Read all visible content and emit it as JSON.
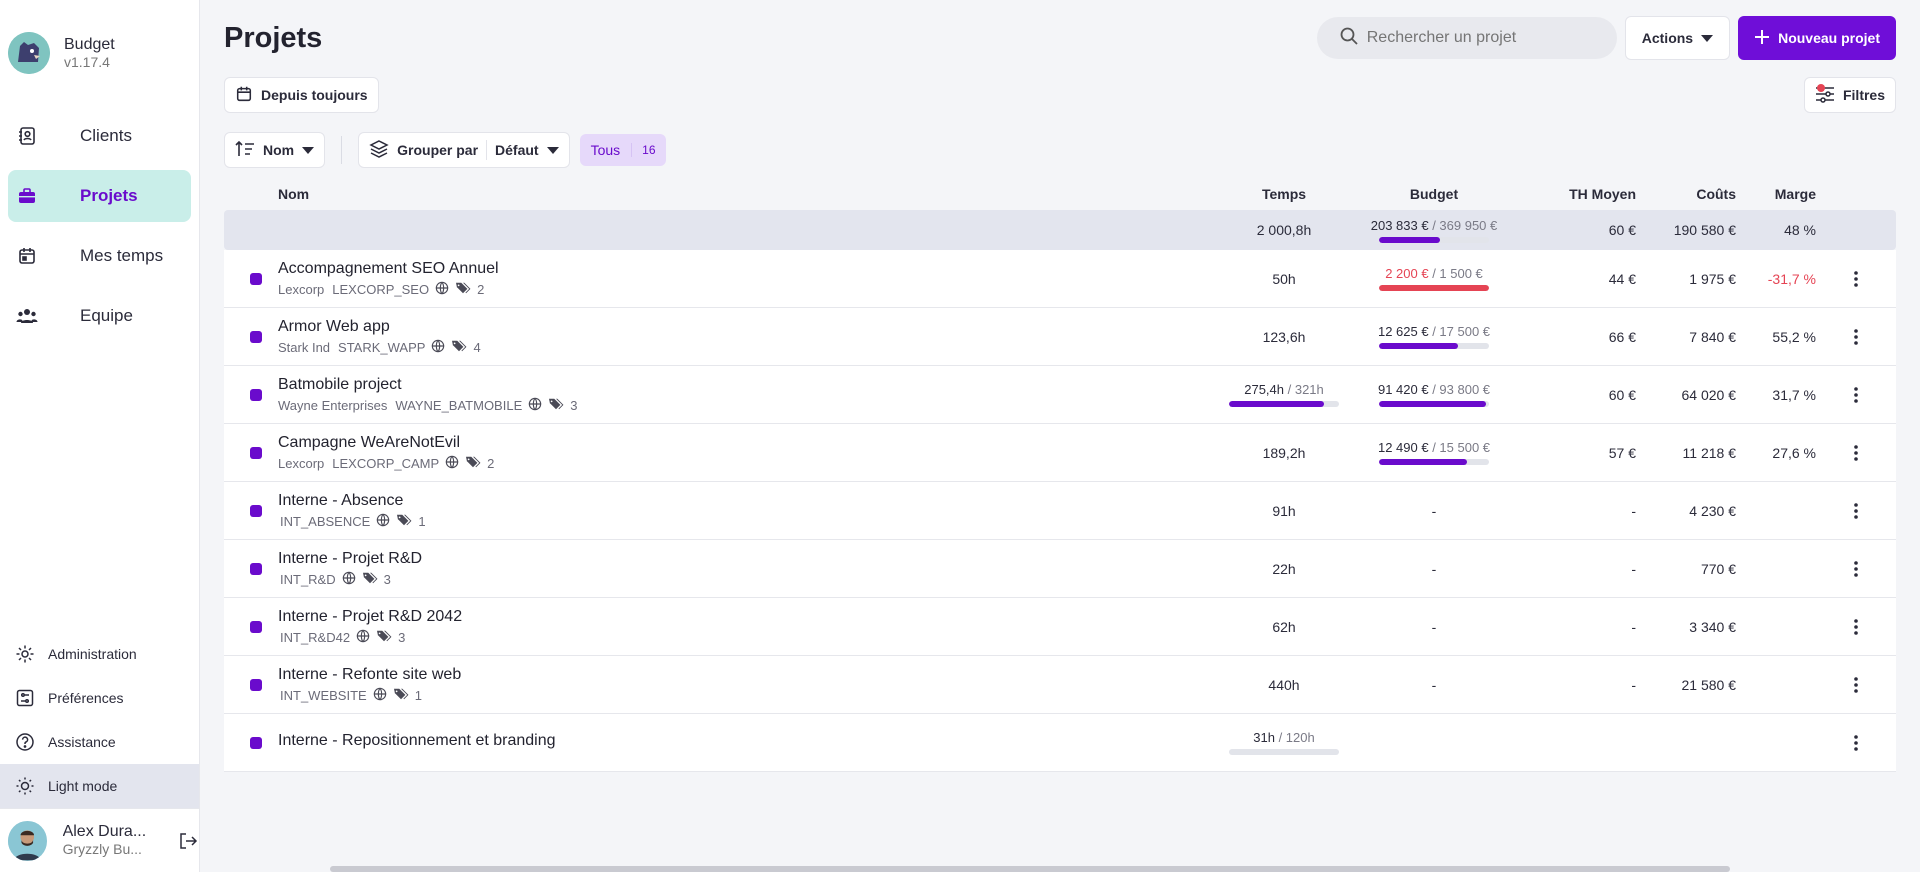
{
  "app": {
    "name": "Budget",
    "version": "v1.17.4"
  },
  "nav": [
    {
      "label": "Clients",
      "icon": "contacts-icon"
    },
    {
      "label": "Projets",
      "icon": "briefcase-icon"
    },
    {
      "label": "Mes temps",
      "icon": "calendar-icon"
    },
    {
      "label": "Equipe",
      "icon": "team-icon"
    }
  ],
  "bottom_nav": [
    {
      "label": "Administration",
      "icon": "gear-icon"
    },
    {
      "label": "Préférences",
      "icon": "sliders-icon"
    },
    {
      "label": "Assistance",
      "icon": "help-icon"
    },
    {
      "label": "Light mode",
      "icon": "sun-icon"
    }
  ],
  "user": {
    "name": "Alex Dura...",
    "org": "Gryzzly Bu..."
  },
  "header": {
    "title": "Projets",
    "search_placeholder": "Rechercher un projet",
    "actions_label": "Actions",
    "new_label": "Nouveau projet"
  },
  "period": {
    "label": "Depuis toujours"
  },
  "filters": {
    "label": "Filtres"
  },
  "toolbar": {
    "sort_label": "Nom",
    "group_label": "Grouper par",
    "group_value": "Défaut",
    "tous_label": "Tous",
    "tous_count": "16"
  },
  "columns": {
    "name": "Nom",
    "temps": "Temps",
    "budget": "Budget",
    "th": "TH Moyen",
    "couts": "Coûts",
    "marge": "Marge"
  },
  "totals": {
    "temps": "2 000,8h",
    "budget_spent": "203 833 €",
    "budget_total": " / 369 950 €",
    "budget_ratio": 0.55,
    "th": "60 €",
    "couts": "190 580 €",
    "marge": "48 %"
  },
  "rows": [
    {
      "name": "Accompagnement SEO Annuel",
      "client": "Lexcorp",
      "code": "LEXCORP_SEO",
      "tags": "2",
      "temps": "50h",
      "budget_spent": "2 200 €",
      "budget_total": " / 1 500 €",
      "budget_ratio": 1.0,
      "over": true,
      "th": "44 €",
      "couts": "1 975 €",
      "marge": "-31,7 %",
      "marge_neg": true
    },
    {
      "name": "Armor Web app",
      "client": "Stark Ind",
      "code": "STARK_WAPP",
      "tags": "4",
      "temps": "123,6h",
      "budget_spent": "12 625 €",
      "budget_total": " / 17 500 €",
      "budget_ratio": 0.72,
      "th": "66 €",
      "couts": "7 840 €",
      "marge": "55,2 %"
    },
    {
      "name": "Batmobile project",
      "client": "Wayne Enterprises",
      "code": "WAYNE_BATMOBILE",
      "tags": "3",
      "temps_spent": "275,4h",
      "temps_total": " / 321h",
      "temps_ratio": 0.86,
      "budget_spent": "91 420 €",
      "budget_total": " / 93 800 €",
      "budget_ratio": 0.97,
      "th": "60 €",
      "couts": "64 020 €",
      "marge": "31,7 %"
    },
    {
      "name": "Campagne WeAreNotEvil",
      "client": "Lexcorp",
      "code": "LEXCORP_CAMP",
      "tags": "2",
      "temps": "189,2h",
      "budget_spent": "12 490 €",
      "budget_total": " / 15 500 €",
      "budget_ratio": 0.8,
      "th": "57 €",
      "couts": "11 218 €",
      "marge": "27,6 %"
    },
    {
      "name": "Interne - Absence",
      "client": "",
      "code": "INT_ABSENCE",
      "tags": "1",
      "temps": "91h",
      "budget": "-",
      "th": "-",
      "couts": "4 230 €",
      "marge": ""
    },
    {
      "name": "Interne - Projet R&D",
      "client": "",
      "code": "INT_R&D",
      "tags": "3",
      "temps": "22h",
      "budget": "-",
      "th": "-",
      "couts": "770 €",
      "marge": ""
    },
    {
      "name": "Interne - Projet R&D 2042",
      "client": "",
      "code": "INT_R&D42",
      "tags": "3",
      "temps": "62h",
      "budget": "-",
      "th": "-",
      "couts": "3 340 €",
      "marge": ""
    },
    {
      "name": "Interne - Refonte site web",
      "client": "",
      "code": "INT_WEBSITE",
      "tags": "1",
      "temps": "440h",
      "budget": "-",
      "th": "-",
      "couts": "21 580 €",
      "marge": ""
    },
    {
      "name": "Interne - Repositionnement et branding",
      "client": "",
      "code": "",
      "tags": "",
      "temps_spent": "31h",
      "temps_total": " / 120h",
      "budget": "",
      "th": "",
      "couts": "",
      "marge": ""
    }
  ],
  "colors": {
    "accent": "#6f0ed8",
    "active_bg": "#c9eee9",
    "danger": "#e54454"
  }
}
